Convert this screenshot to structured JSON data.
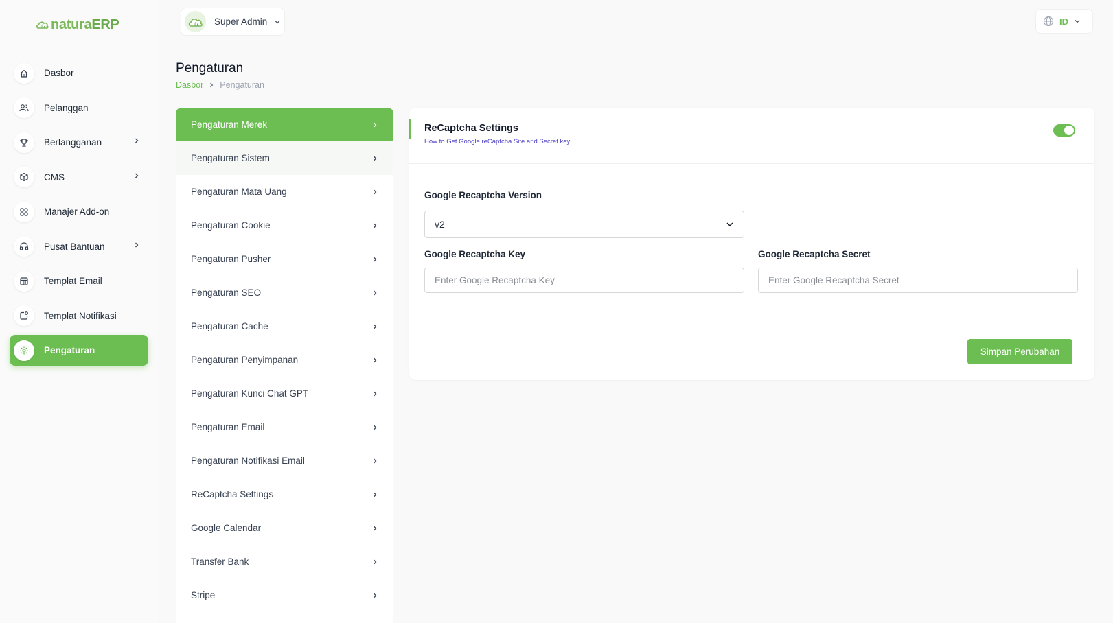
{
  "brand": {
    "name_part1": "natura",
    "name_part2": "ERP"
  },
  "sidebar": {
    "items": [
      {
        "label": "Dasbor",
        "icon": "home-icon",
        "has_submenu": false
      },
      {
        "label": "Pelanggan",
        "icon": "users-icon",
        "has_submenu": false
      },
      {
        "label": "Berlangganan",
        "icon": "trophy-icon",
        "has_submenu": true
      },
      {
        "label": "CMS",
        "icon": "cube-icon",
        "has_submenu": true
      },
      {
        "label": "Manajer Add-on",
        "icon": "grid-icon",
        "has_submenu": false
      },
      {
        "label": "Pusat Bantuan",
        "icon": "headset-icon",
        "has_submenu": true
      },
      {
        "label": "Templat Email",
        "icon": "template-icon",
        "has_submenu": false
      },
      {
        "label": "Templat Notifikasi",
        "icon": "notification-icon",
        "has_submenu": false
      },
      {
        "label": "Pengaturan",
        "icon": "gear-icon",
        "has_submenu": false,
        "active": true
      }
    ]
  },
  "topbar": {
    "role": "Super Admin",
    "language": "ID"
  },
  "page": {
    "title": "Pengaturan",
    "breadcrumb": {
      "home": "Dasbor",
      "current": "Pengaturan"
    }
  },
  "settings_menu": [
    "Pengaturan Merek",
    "Pengaturan Sistem",
    "Pengaturan Mata Uang",
    "Pengaturan Cookie",
    "Pengaturan Pusher",
    "Pengaturan SEO",
    "Pengaturan Cache",
    "Pengaturan Penyimpanan",
    "Pengaturan Kunci Chat GPT",
    "Pengaturan Email",
    "Pengaturan Notifikasi Email",
    "ReCaptcha Settings",
    "Google Calendar",
    "Transfer Bank",
    "Stripe"
  ],
  "recaptcha": {
    "title": "ReCaptcha Settings",
    "help_link": "How to Get Google reCaptcha Site and Secret key",
    "enabled": true,
    "version_label": "Google Recaptcha Version",
    "version_value": "v2",
    "key_label": "Google Recaptcha Key",
    "key_value": "",
    "key_placeholder": "Enter Google Recaptcha Key",
    "secret_label": "Google Recaptcha Secret",
    "secret_value": "",
    "secret_placeholder": "Enter Google Recaptcha Secret",
    "save_label": "Simpan Perubahan"
  },
  "colors": {
    "accent": "#6cbd52",
    "link": "#4b3fc4"
  }
}
